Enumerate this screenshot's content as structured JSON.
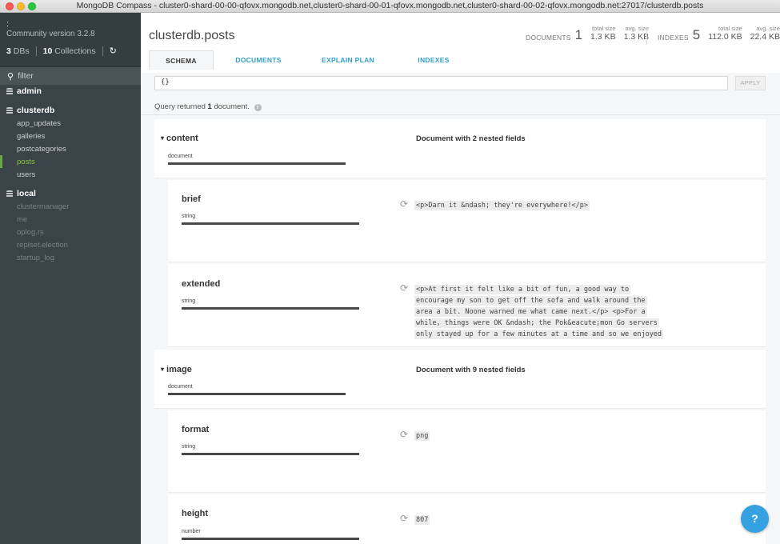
{
  "window": {
    "title": "MongoDB Compass - cluster0-shard-00-00-qfovx.mongodb.net,cluster0-shard-00-01-qfovx.mongodb.net,cluster0-shard-00-02-qfovx.mongodb.net:27017/clusterdb.posts"
  },
  "sidebar": {
    "host": ":",
    "version": "Community version 3.2.8",
    "db_count": "3",
    "db_label": "DBs",
    "coll_count": "10",
    "coll_label": "Collections",
    "refresh_icon": "↻",
    "filter_placeholder": "filter",
    "databases": [
      {
        "name": "admin",
        "collections": []
      },
      {
        "name": "clusterdb",
        "collections": [
          "app_updates",
          "galleries",
          "postcategories",
          "posts",
          "users"
        ]
      },
      {
        "name": "local",
        "collections": [
          "clustermanager",
          "me",
          "oplog.rs",
          "replset.election",
          "startup_log"
        ]
      }
    ]
  },
  "header": {
    "collection_title": "clusterdb.posts",
    "documents_label": "DOCUMENTS",
    "documents_count": "1",
    "doc_total_size_label": "total size",
    "doc_total_size": "1.3 KB",
    "doc_avg_size_label": "avg. size",
    "doc_avg_size": "1.3 KB",
    "indexes_label": "INDEXES",
    "indexes_count": "5",
    "idx_total_size_label": "total size",
    "idx_total_size": "112.0 KB",
    "idx_avg_size_label": "avg. size",
    "idx_avg_size": "22.4 KB"
  },
  "tabs": [
    "SCHEMA",
    "DOCUMENTS",
    "EXPLAIN PLAN",
    "INDEXES"
  ],
  "query": {
    "value": "{}",
    "apply_label": "APPLY",
    "msg_prefix": "Query returned",
    "msg_count": "1",
    "msg_suffix": "document."
  },
  "fields": {
    "content": {
      "name": "content",
      "type": "document",
      "nested": "Document with 2 nested fields"
    },
    "brief": {
      "name": "brief",
      "type": "string",
      "sample": "<p>Darn it &ndash; they're everywhere!</p>"
    },
    "extended": {
      "name": "extended",
      "type": "string",
      "sample_lines": [
        "<p>At first it felt like a bit of fun, a good way to",
        "encourage my son to get off the sofa and walk around the",
        "area a bit. Noone warned me what came next.</p> <p>For a",
        "while, things were OK &ndash; the Pok&eacute;mon Go servers",
        "only stayed up for a few minutes at a time and so we enjoyed"
      ]
    },
    "image": {
      "name": "image",
      "type": "document",
      "nested": "Document with 9 nested fields"
    },
    "format": {
      "name": "format",
      "type": "string",
      "sample": "png"
    },
    "height": {
      "name": "height",
      "type": "number",
      "sample": "807"
    }
  },
  "help_icon": "?",
  "colors": {
    "sidebar_bg": "#3a4448",
    "active_collection": "#8dc33e",
    "tab_link": "#2f9fc9",
    "help_button": "#36a1e0"
  }
}
